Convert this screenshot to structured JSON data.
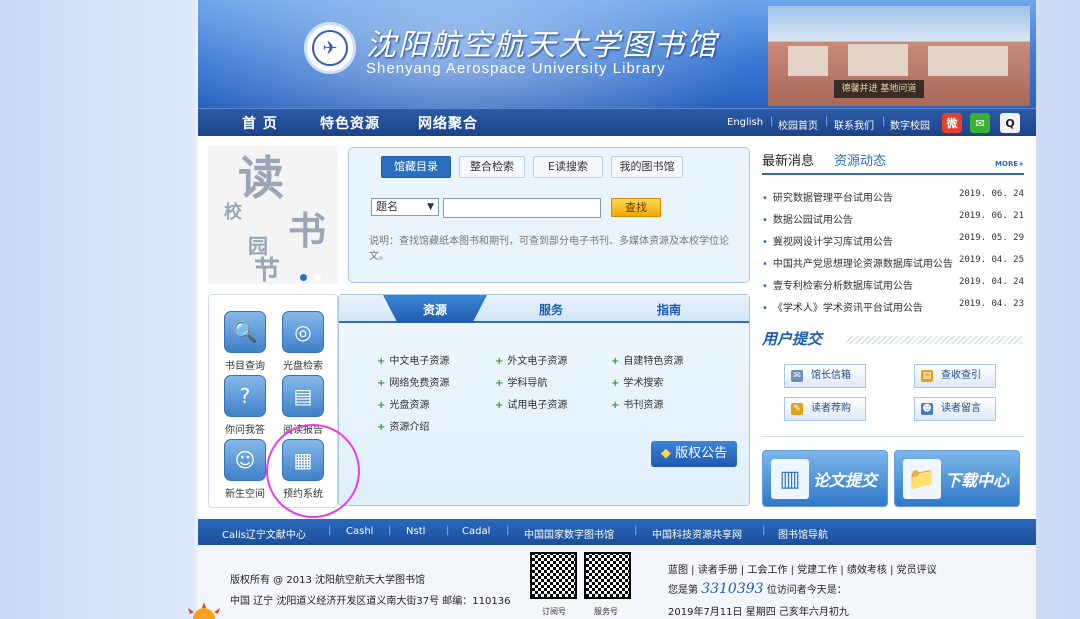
{
  "header": {
    "title_cn": "沈阳航空航天大学图书馆",
    "title_en": "Shenyang Aerospace University Library",
    "building_sign": "德馨并进 基地问道"
  },
  "nav": {
    "items": [
      "首 页",
      "特色资源",
      "网络聚合"
    ],
    "top_links": [
      "English",
      "校园首页",
      "联系我们",
      "数字校园"
    ],
    "social_icons": [
      "weibo-icon",
      "wechat-icon",
      "qq-icon"
    ]
  },
  "banner": {
    "chars": [
      "读",
      "校",
      "书",
      "园",
      "节"
    ]
  },
  "search": {
    "tabs": [
      "馆藏目录",
      "整合检索",
      "E读搜索",
      "我的图书馆"
    ],
    "select_value": "题名",
    "input_value": "",
    "button": "查找",
    "description": "说明：查找馆藏纸本图书和期刊，可查到部分电子书刊、多媒体资源及本校学位论文。"
  },
  "news": {
    "tabs": [
      "最新消息",
      "资源动态"
    ],
    "more": "MORE+",
    "items": [
      {
        "title": "研究数据管理平台试用公告",
        "date": "2019. 06. 24"
      },
      {
        "title": "数据公园试用公告",
        "date": "2019. 06. 21"
      },
      {
        "title": "冀视网设计学习库试用公告",
        "date": "2019. 05. 29"
      },
      {
        "title": "中国共产党思想理论资源数据库试用公告",
        "date": "2019. 04. 25"
      },
      {
        "title": "壹专利检索分析数据库试用公告",
        "date": "2019. 04. 24"
      },
      {
        "title": "《学术人》学术资讯平台试用公告",
        "date": "2019. 04. 23"
      }
    ]
  },
  "quick": {
    "items": [
      {
        "label": "书目查询",
        "icon": "magnifier-icon"
      },
      {
        "label": "光盘检索",
        "icon": "disc-icon"
      },
      {
        "label": "你问我答",
        "icon": "qa-icon"
      },
      {
        "label": "阅读报告",
        "icon": "report-icon"
      },
      {
        "label": "新生空间",
        "icon": "astronaut-icon"
      },
      {
        "label": "预约系统",
        "icon": "monitor-icon"
      }
    ]
  },
  "resources": {
    "tabs": [
      "资源",
      "服务",
      "指南"
    ],
    "items": [
      "中文电子资源",
      "外文电子资源",
      "自建特色资源",
      "网络免费资源",
      "学科导航",
      "学术搜索",
      "光盘资源",
      "试用电子资源",
      "书刊资源",
      "资源介绍"
    ],
    "copyright_label": "版权公告"
  },
  "user": {
    "title": "用户提交",
    "buttons": [
      "馆长信箱",
      "查收查引",
      "读者荐购",
      "读者留言"
    ],
    "big_buttons": [
      "论文提交",
      "下载中心"
    ]
  },
  "footer_links": [
    "Calis辽宁文献中心",
    "Cashl",
    "Nstl",
    "Cadal",
    "中国国家数字图书馆",
    "中国科技资源共享网",
    "图书馆导航"
  ],
  "footer": {
    "copyright": "版权所有 @ 2013 沈阳航空航天大学图书馆",
    "address": "中国 辽宁 沈阳道义经济开发区道义南大街37号 邮编：110136",
    "qr_labels": [
      "订阅号",
      "服务号"
    ],
    "links": "蓝图 | 读者手册 | 工会工作 | 党建工作 | 绩效考核 | 党员评议",
    "visitor_prefix": "您是第",
    "visitor_count": "3310393",
    "visitor_suffix": "位访问者今天是：",
    "date": "2019年7月11日  星期四  己亥年六月初九"
  },
  "colors": {
    "accent": "#2a6fbe",
    "highlight_circle": "#e93be9",
    "nav_bg": "#1c4388"
  }
}
